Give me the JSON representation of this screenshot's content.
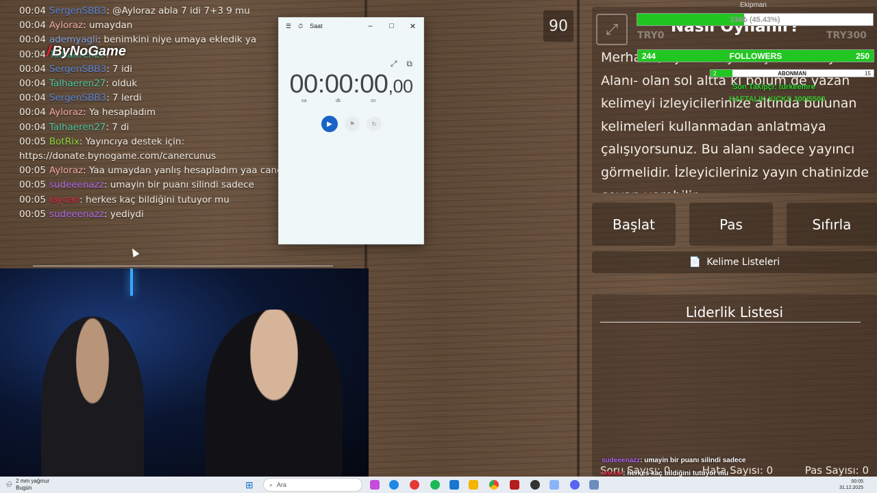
{
  "chat": {
    "messages": [
      {
        "time": "00:04",
        "user": "SergenSBB3",
        "color": "#5b86d6",
        "text": ": @Ayloraz abla 7 idi 7+3 9 mu"
      },
      {
        "time": "00:04",
        "user": "Ayloraz",
        "color": "#f2a8a8",
        "text": ": umaydan"
      },
      {
        "time": "00:04",
        "user": "ademyagli",
        "color": "#7fa3e8",
        "text": ": benimkini niye umaya ekledik ya"
      },
      {
        "time": "00:04",
        "user": "Talhaeren27",
        "color": "#4ec9a6",
        "text": ":"
      },
      {
        "time": "00:04",
        "user": "SergenSBB3",
        "color": "#5b86d6",
        "text": ": 7 idi"
      },
      {
        "time": "00:04",
        "user": "Talhaeren27",
        "color": "#4ec9a6",
        "text": ": olduk"
      },
      {
        "time": "00:04",
        "user": "SergenSBB3",
        "color": "#5b86d6",
        "text": ": 7 lerdi"
      },
      {
        "time": "00:04",
        "user": "Ayloraz",
        "color": "#f2a8a8",
        "text": ": Ya hesapladım"
      },
      {
        "time": "00:04",
        "user": "Talhaeren27",
        "color": "#4ec9a6",
        "text": ": 7 di"
      },
      {
        "time": "00:05",
        "user": "BotRix",
        "color": "#8ddb3c",
        "text": ": Yayıncıya destek için:"
      },
      {
        "time": "",
        "user": "",
        "color": "#ffffff",
        "text": "https://donate.bynogame.com/canercunus"
      },
      {
        "time": "00:05",
        "user": "Ayloraz",
        "color": "#f2a8a8",
        "text": ": Yaa umaydan yanlış hesapladım yaa canerrr"
      },
      {
        "time": "00:05",
        "user": "sudeeenazz",
        "color": "#b46cf0",
        "text": ": umayin bir puanı silindi sadece"
      },
      {
        "time": "00:05",
        "user": "laycan",
        "color": "#e0243f",
        "text": ": herkes kaç bildiğini tutuyor mu"
      },
      {
        "time": "00:05",
        "user": "sudeeenazz",
        "color": "#b46cf0",
        "text": ": yediydi"
      }
    ]
  },
  "logo": {
    "text": "ByNoGame"
  },
  "clock_app": {
    "title": "Saat",
    "time": "00:00:00",
    "ms": ",00",
    "units": [
      "sa",
      "dk",
      "sn"
    ]
  },
  "counter": "90",
  "howto": {
    "title": "Nasıl Oynanır?",
    "body": "Merhaba, oyunun oynanış alanı - Oyun Alanı- olan sol altta ki bölüm de yazan kelimeyi izleyicilerinize altında bulunan kelimeleri kullanmadan anlatmaya çalışıyorsunuz. Bu alanı sadece yayıncı görmelidir. İzleyicileriniz yayın chatinizde cevap verebilir."
  },
  "buttons": {
    "start": "Başlat",
    "pass": "Pas",
    "reset": "Sıfırla",
    "wordlists": "Kelime Listeleri"
  },
  "leaderboard": {
    "title": "Liderlik Listesi",
    "stats": [
      "Soru Sayısı: 0",
      "Hata Sayısı: 0",
      "Pas Sayısı: 0"
    ]
  },
  "overlay": {
    "ekip_label": "Ekipman",
    "bar1": {
      "label": "136₺ (45.43%)",
      "progress": 0.4543
    },
    "try_left": "TRY0",
    "try_right": "TRY300",
    "followers": {
      "label": "FOLLOWERS",
      "current": "244",
      "goal": "250",
      "progress": 0.976
    },
    "subs": {
      "label": "ABONMAN",
      "current": "2",
      "goal": "15",
      "progress": 0.133
    },
    "last_follower": "Son Takipçi: turkeemre",
    "kicks": "HAFTALIK KICKS 300/5500"
  },
  "overlay_chat": [
    {
      "user": "sudeeenazz",
      "color": "#b46cf0",
      "text": ": umayin bir puanı silindi sadece"
    },
    {
      "user": "laycan",
      "color": "#e0243f",
      "text": ": herkes kaç bildiğini tutuyor mu"
    },
    {
      "user": "sudeeenazz",
      "color": "#b46cf0",
      "text": ": yediydi"
    }
  ],
  "taskbar": {
    "weather_temp": "2 mm yağmur",
    "weather_day": "Bugün",
    "search_placeholder": "Ara",
    "time": "00:05",
    "date": "31.12.2025"
  }
}
